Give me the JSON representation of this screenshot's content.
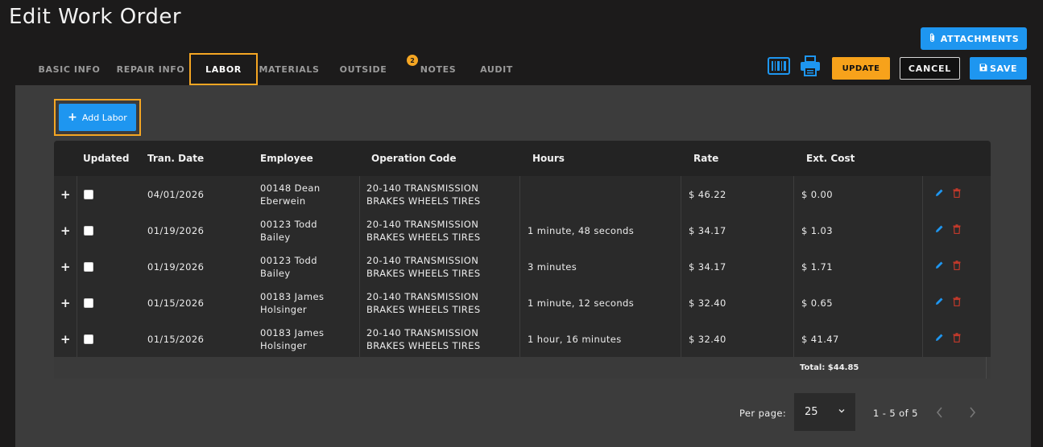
{
  "header": {
    "title": "Edit Work Order",
    "attachments_label": "ATTACHMENTS"
  },
  "tabs": [
    {
      "label": "BASIC INFO"
    },
    {
      "label": "REPAIR INFO"
    },
    {
      "label": "LABOR",
      "active": true
    },
    {
      "label": "MATERIALS"
    },
    {
      "label": "OUTSIDE"
    },
    {
      "label": "NOTES",
      "badge": "2"
    },
    {
      "label": "AUDIT"
    }
  ],
  "toolbar": {
    "barcode_icon": "barcode-icon",
    "print_icon": "printer-icon",
    "update_label": "UPDATE",
    "cancel_label": "CANCEL",
    "save_label": "SAVE"
  },
  "labor": {
    "add_label": "Add Labor",
    "columns": [
      "Updated",
      "Tran. Date",
      "Employee",
      "Operation Code",
      "Hours",
      "Rate",
      "Ext. Cost"
    ],
    "rows": [
      {
        "date": "04/01/2026",
        "employee": [
          "00148 Dean",
          "Eberwein"
        ],
        "operation": [
          "20-140 TRANSMISSION",
          "BRAKES WHEELS TIRES"
        ],
        "hours": "",
        "rate": "$ 46.22",
        "cost": "$ 0.00"
      },
      {
        "date": "01/19/2026",
        "employee": [
          "00123 Todd",
          "Bailey"
        ],
        "operation": [
          "20-140 TRANSMISSION",
          "BRAKES WHEELS TIRES"
        ],
        "hours": "1 minute, 48 seconds",
        "rate": "$ 34.17",
        "cost": "$ 1.03"
      },
      {
        "date": "01/19/2026",
        "employee": [
          "00123 Todd",
          "Bailey"
        ],
        "operation": [
          "20-140 TRANSMISSION",
          "BRAKES WHEELS TIRES"
        ],
        "hours": "3 minutes",
        "rate": "$ 34.17",
        "cost": "$ 1.71"
      },
      {
        "date": "01/15/2026",
        "employee": [
          "00183 James",
          "Holsinger"
        ],
        "operation": [
          "20-140 TRANSMISSION",
          "BRAKES WHEELS TIRES"
        ],
        "hours": "1 minute, 12 seconds",
        "rate": "$ 32.40",
        "cost": "$ 0.65"
      },
      {
        "date": "01/15/2026",
        "employee": [
          "00183 James",
          "Holsinger"
        ],
        "operation": [
          "20-140 TRANSMISSION",
          "BRAKES WHEELS TIRES"
        ],
        "hours": "1 hour, 16 minutes",
        "rate": "$ 32.40",
        "cost": "$ 41.47"
      }
    ],
    "total": "Total: $44.85"
  },
  "pagination": {
    "per_page_label": "Per page:",
    "per_page_value": "25",
    "range": "1 - 5 of 5"
  },
  "colors": {
    "accent_blue": "#1e96f0",
    "accent_orange": "#f7a21b",
    "background": "#1c1b1b",
    "panel": "#3c3c3c",
    "delete_red": "#c0392b"
  }
}
